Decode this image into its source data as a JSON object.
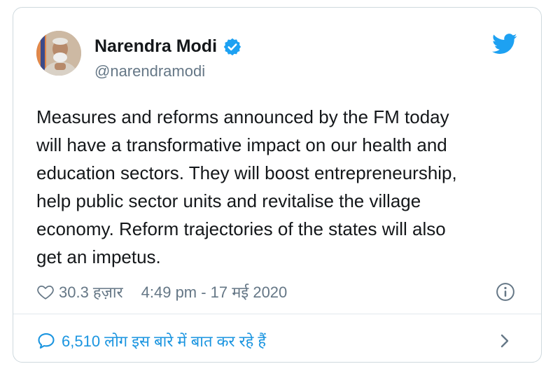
{
  "author": {
    "name": "Narendra Modi",
    "handle": "@narendramodi"
  },
  "tweet": {
    "text": "Measures and reforms announced by the FM today\nwill have a transformative impact on our health and\neducation sectors. They will boost entrepreneurship,\nhelp public sector units and revitalise the village\neconomy. Reform trajectories of the states will also\nget an impetus."
  },
  "meta": {
    "likes": "30.3 हज़ार",
    "timestamp": "4:49 pm - 17 मई 2020"
  },
  "footer": {
    "conversation": "6,510 लोग इस बारे में बात कर रहे हैं"
  },
  "colors": {
    "accent": "#1da1f2",
    "link": "#1b95e0",
    "muted": "#657786",
    "text": "#14171a",
    "border": "#cfd9de"
  },
  "icons": [
    "avatar-photo",
    "verified-badge-icon",
    "twitter-bird-icon",
    "heart-icon",
    "info-icon",
    "speech-bubble-icon",
    "chevron-right-icon"
  ]
}
